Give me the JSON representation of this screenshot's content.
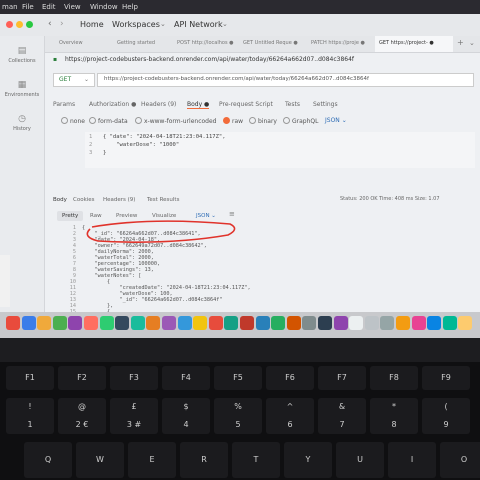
{
  "menubar": {
    "items": [
      "man",
      "File",
      "Edit",
      "View",
      "Window",
      "Help"
    ]
  },
  "toolbar": {
    "home": "Home",
    "workspaces": "Workspaces",
    "api_network": "API Network"
  },
  "sidebar": {
    "items": [
      {
        "label": "Collections",
        "icon": "collections-icon"
      },
      {
        "label": "Environments",
        "icon": "environments-icon"
      },
      {
        "label": "History",
        "icon": "history-icon"
      }
    ]
  },
  "tabs": [
    {
      "label": "Overview"
    },
    {
      "label": "Getting started"
    },
    {
      "label": "POST http://localhos ●"
    },
    {
      "label": "GET Untitled Reque ●"
    },
    {
      "label": "PATCH https://proje ●"
    },
    {
      "label": "GET https://project- ●"
    }
  ],
  "request": {
    "title_url": "https://project-codebusters-backend.onrender.com/api/water/today/66264a662d07..d084c3864f",
    "method": "GET",
    "url": "https://project-codebusters-backend.onrender.com/api/water/today/66264a662d07..d084c3864f",
    "tabs": [
      "Params",
      "Authorization ●",
      "Headers (9)",
      "Body ●",
      "Pre-request Script",
      "Tests",
      "Settings"
    ],
    "body_modes": [
      "none",
      "form-data",
      "x-www-form-urlencoded",
      "raw",
      "binary",
      "GraphQL",
      "JSON ⌄"
    ],
    "selected_mode": "raw",
    "body_lines": [
      "{ \"date\": \"2024-04-18T21:23:04.117Z\",",
      "    \"waterDose\": \"1000\"",
      "}"
    ]
  },
  "response": {
    "tabs": [
      "Body",
      "Cookies",
      "Headers (9)",
      "Test Results"
    ],
    "status": "Status: 200 OK   Time: 408 ms   Size: 1.07",
    "view_tabs": [
      "Pretty",
      "Raw",
      "Preview",
      "Visualize",
      "JSON ⌄"
    ],
    "lines": [
      {
        "n": "1",
        "t": "{"
      },
      {
        "n": "2",
        "t": "    \"_id\": \"66264a662d07..d084c38641\","
      },
      {
        "n": "3",
        "t": "    \"date\": \"2024-04-18\","
      },
      {
        "n": "4",
        "t": "    \"owner\": \"662649a72d07..d084c38642\","
      },
      {
        "n": "5",
        "t": "    \"dailyNorma\": 2000,"
      },
      {
        "n": "6",
        "t": "    \"waterTotal\": 2000,"
      },
      {
        "n": "7",
        "t": "    \"percentage\": 100000,"
      },
      {
        "n": "8",
        "t": "    \"waterSavings\": 13,"
      },
      {
        "n": "9",
        "t": "    \"waterNotes\": ["
      },
      {
        "n": "10",
        "t": "        {"
      },
      {
        "n": "11",
        "t": "            \"createdDate\": \"2024-04-18T21:23:04.117Z\","
      },
      {
        "n": "12",
        "t": "            \"waterDose\": 100,"
      },
      {
        "n": "13",
        "t": "            \"_id\": \"66264a662d07..d084c3864f\""
      },
      {
        "n": "14",
        "t": "        },"
      },
      {
        "n": "15",
        "t": "        {"
      },
      {
        "n": "16",
        "t": "            \"createdDate\": \"2024-04-18T21:23:04.117Z\","
      }
    ]
  },
  "keyboard": {
    "fkeys": [
      "F1",
      "F2",
      "F3",
      "F4",
      "F5",
      "F6",
      "F7",
      "F8",
      "F9"
    ],
    "numbers": [
      "!\n1",
      "@\n2 €",
      "£\n3 #",
      "$\n4",
      "%\n5",
      "^\n6",
      "&\n7",
      "*\n8",
      "(\n9"
    ],
    "letters": [
      "Q",
      "W",
      "E",
      "R",
      "T",
      "Y",
      "U",
      "I",
      "O"
    ]
  }
}
